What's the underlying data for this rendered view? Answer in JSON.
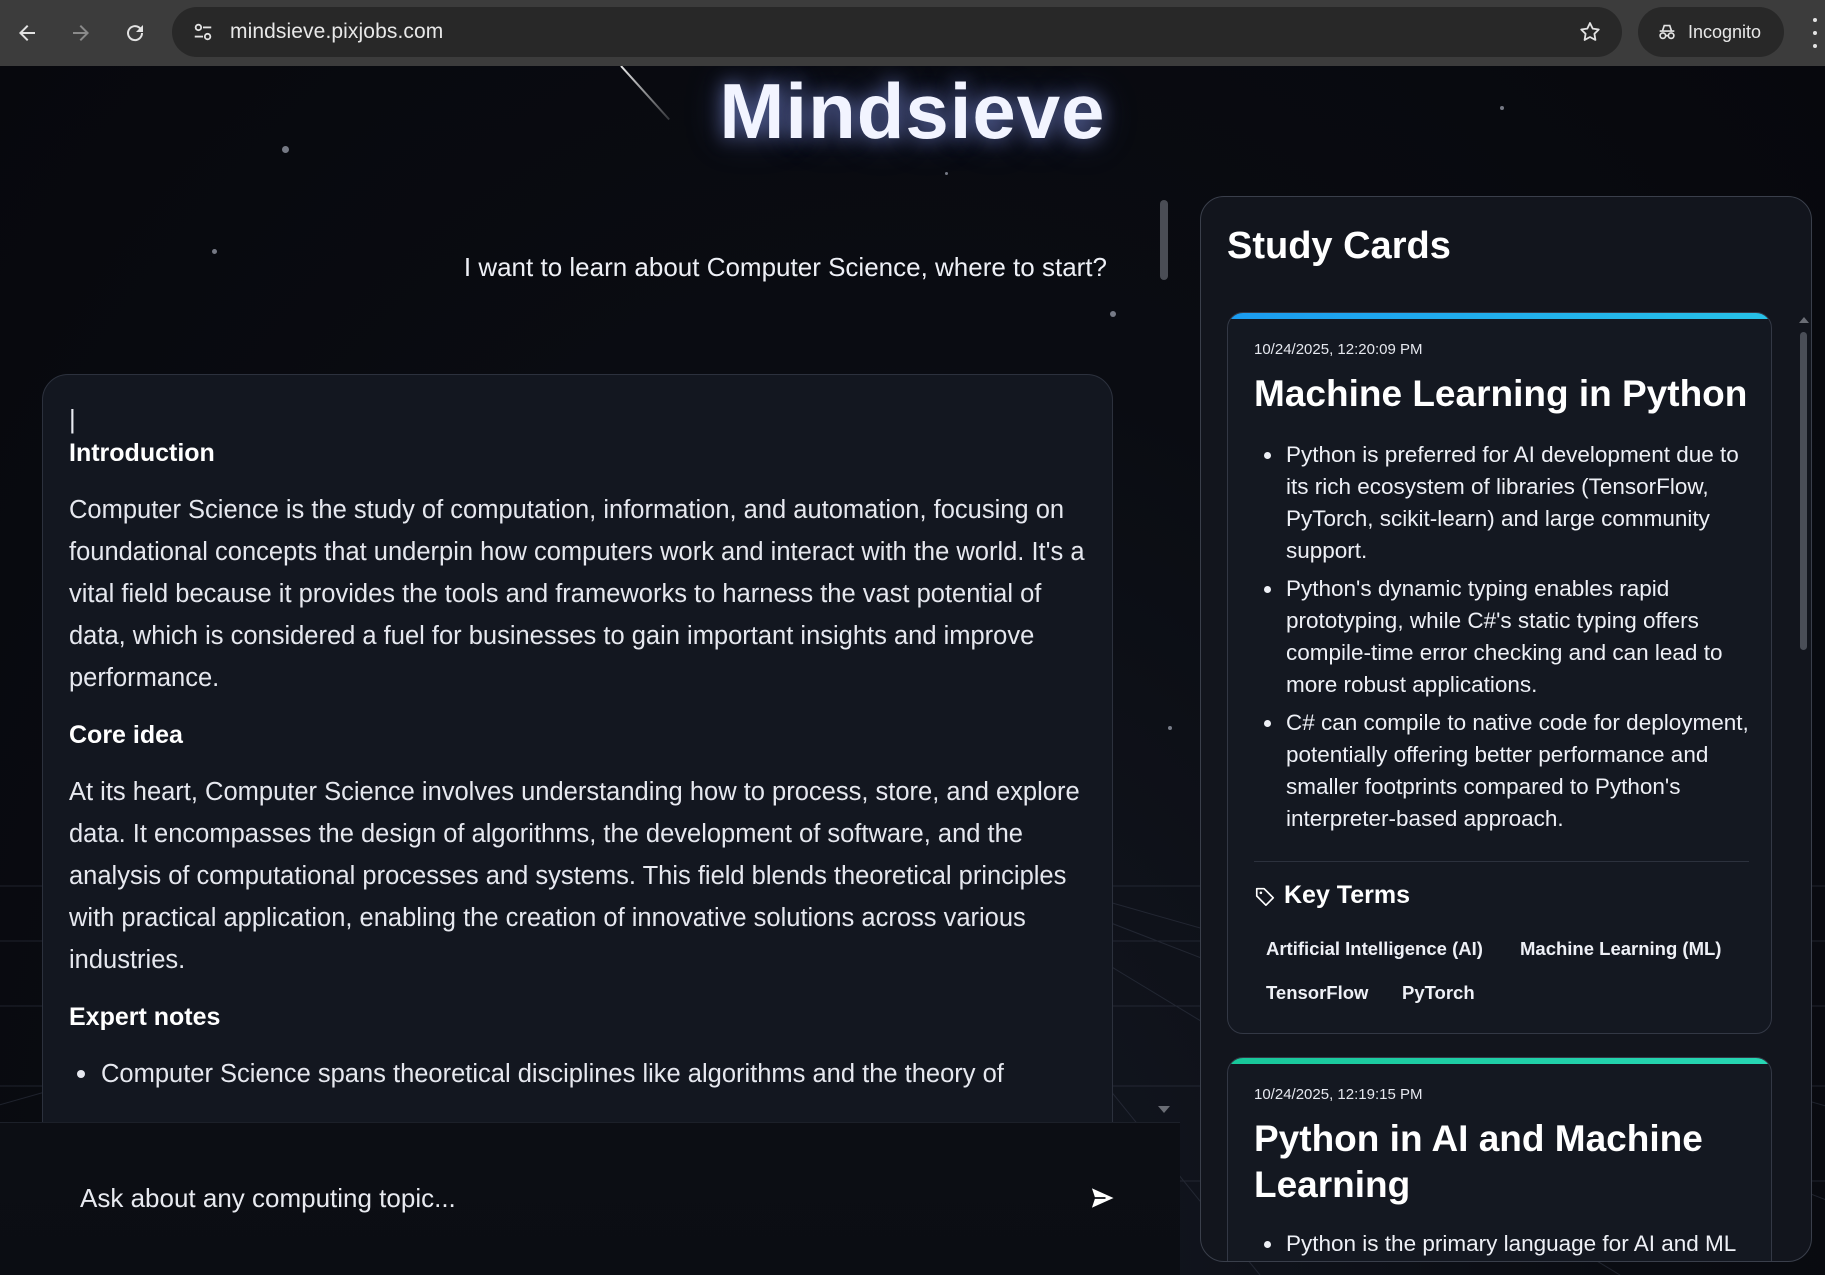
{
  "browser": {
    "url": "mindsieve.pixjobs.com",
    "profile_label": "Incognito"
  },
  "app": {
    "title": "Mindsieve"
  },
  "chat": {
    "user_message": "I want to learn about Computer Science, where to start?",
    "answer": {
      "cursor": "|",
      "sections": [
        {
          "heading": "Introduction",
          "body": "Computer Science is the study of computation, information, and automation, focusing on foundational concepts that underpin how computers work and interact with the world. It's a vital field because it provides the tools and frameworks to harness the vast potential of data, which is considered a fuel for businesses to gain important insights and improve performance."
        },
        {
          "heading": "Core idea",
          "body": "At its heart, Computer Science involves understanding how to process, store, and explore data. It encompasses the design of algorithms, the development of software, and the analysis of computational processes and systems. This field blends theoretical principles with practical application, enabling the creation of innovative solutions across various industries."
        },
        {
          "heading": "Expert notes",
          "bullets": [
            "Computer Science spans theoretical disciplines like algorithms and the theory of"
          ]
        }
      ]
    },
    "composer": {
      "placeholder": "Ask about any computing topic..."
    }
  },
  "study_cards": {
    "title": "Study Cards",
    "cards": [
      {
        "date": "10/24/2025, 12:20:09 PM",
        "title": "Machine Learning in Python",
        "accent_color": "#1eaaf1",
        "points": [
          "Python is preferred for AI development due to its rich ecosystem of libraries (TensorFlow, PyTorch, scikit-learn) and large community support.",
          "Python's dynamic typing enables rapid prototyping, while C#'s static typing offers compile-time error checking and can lead to more robust applications.",
          "C# can compile to native code for deployment, potentially offering better performance and smaller footprints compared to Python's interpreter-based approach."
        ],
        "key_terms_label": "Key Terms",
        "key_terms": [
          "Artificial Intelligence (AI)",
          "Machine Learning (ML)",
          "TensorFlow",
          "PyTorch"
        ]
      },
      {
        "date": "10/24/2025, 12:19:15 PM",
        "title": "Python in AI and Machine Learning",
        "accent_color": "#1ecfa6",
        "points": [
          "Python is the primary language for AI and ML"
        ]
      }
    ]
  },
  "icons": {
    "back": "arrow-left-icon",
    "forward": "arrow-right-icon",
    "reload": "reload-icon",
    "site_info": "tune-icon",
    "bookmark": "star-icon",
    "incognito": "incognito-icon",
    "menu": "vertical-dots-icon",
    "send": "send-icon",
    "tag": "tag-icon"
  }
}
